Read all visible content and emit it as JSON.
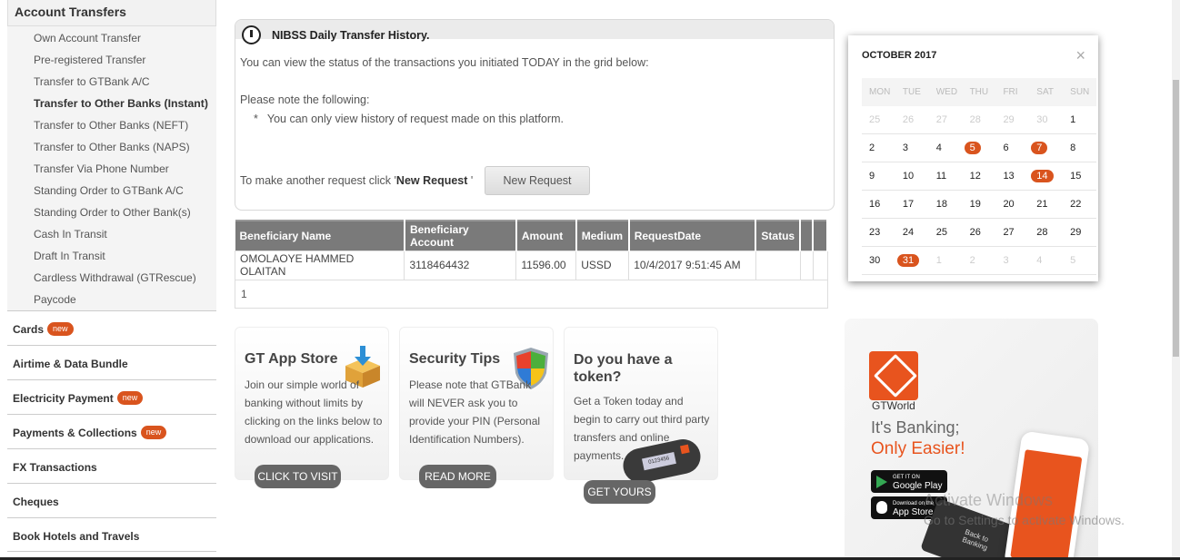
{
  "sidebar": {
    "header": "Account Transfers",
    "sub_items": [
      {
        "label": "Own Account Transfer"
      },
      {
        "label": "Pre-registered Transfer"
      },
      {
        "label": "Transfer to GTBank A/C"
      },
      {
        "label": "Transfer to Other Banks (Instant)"
      },
      {
        "label": "Transfer to Other Banks (NEFT)"
      },
      {
        "label": "Transfer to Other Banks (NAPS)"
      },
      {
        "label": "Transfer Via Phone Number"
      },
      {
        "label": "Standing Order to GTBank A/C"
      },
      {
        "label": "Standing Order to Other Bank(s)"
      },
      {
        "label": "Cash In Transit"
      },
      {
        "label": "Draft In Transit"
      },
      {
        "label": "Cardless Withdrawal (GTRescue)"
      },
      {
        "label": "Paycode"
      }
    ],
    "main_items": [
      {
        "label": "Cards",
        "badge": "new"
      },
      {
        "label": "Airtime & Data Bundle"
      },
      {
        "label": "Electricity Payment",
        "badge": "new"
      },
      {
        "label": "Payments & Collections",
        "badge": "new"
      },
      {
        "label": "FX Transactions"
      },
      {
        "label": "Cheques"
      },
      {
        "label": "Book Hotels and Travels"
      }
    ]
  },
  "info": {
    "title": "NIBSS Daily Transfer History.",
    "line1": "You can view the status of the transactions you initiated TODAY in the grid below:",
    "note_heading": "Please note the following:",
    "bullet_mark": "*",
    "bullet": "You can only view history of request made on this platform.",
    "request_prefix": "To make another request click '",
    "request_bold": "New Request",
    "request_suffix": " '",
    "new_request_button": "New Request"
  },
  "table": {
    "headers": [
      "Beneficiary Name",
      "Beneficiary Account",
      "Amount",
      "Medium",
      "RequestDate",
      "Status",
      "",
      ""
    ],
    "rows": [
      [
        "OMOLAOYE HAMMED OLAITAN",
        "3118464432",
        "11596.00",
        "USSD",
        "10/4/2017 9:51:45 AM",
        "",
        "",
        ""
      ]
    ],
    "page": "1"
  },
  "promos": [
    {
      "title": "GT App Store",
      "text": "Join our simple world of banking without limits by clicking on the links below to download our applications.",
      "button": "CLICK TO VISIT"
    },
    {
      "title": "Security Tips",
      "text": "Please note that GTBank will NEVER ask you to provide your PIN (Personal Identification Numbers).",
      "button": "READ MORE"
    },
    {
      "title": "Do you have a token?",
      "text": "Get a Token today and begin to carry out third party transfers and online payments.",
      "button": "GET YOURS",
      "token_code": "0123456"
    }
  ],
  "calendar": {
    "month": "OCTOBER 2017",
    "close": "×",
    "days": [
      "MON",
      "TUE",
      "WED",
      "THU",
      "FRI",
      "SAT",
      "SUN"
    ],
    "weeks": [
      [
        "25",
        "26",
        "27",
        "28",
        "29",
        "30",
        "1"
      ],
      [
        "2",
        "3",
        "4",
        "5",
        "6",
        "7",
        "8"
      ],
      [
        "9",
        "10",
        "11",
        "12",
        "13",
        "14",
        "15"
      ],
      [
        "16",
        "17",
        "18",
        "19",
        "20",
        "21",
        "22"
      ],
      [
        "23",
        "24",
        "25",
        "26",
        "27",
        "28",
        "29"
      ],
      [
        "30",
        "31",
        "1",
        "2",
        "3",
        "4",
        "5"
      ]
    ],
    "marked": [
      "5",
      "7",
      "14",
      "31"
    ],
    "accent_color": "#d9541e"
  },
  "ad": {
    "brand": "GTWorld",
    "headline1": "It's Banking;",
    "headline2": "Only Easier!",
    "google_small": "GET IT ON",
    "google": "Google Play",
    "apple_small": "Download on the",
    "apple": "App Store",
    "phone_caption": "Back to Banking"
  },
  "watermark": {
    "line1": "Activate Windows",
    "line2": "Go to Settings to activate Windows."
  }
}
